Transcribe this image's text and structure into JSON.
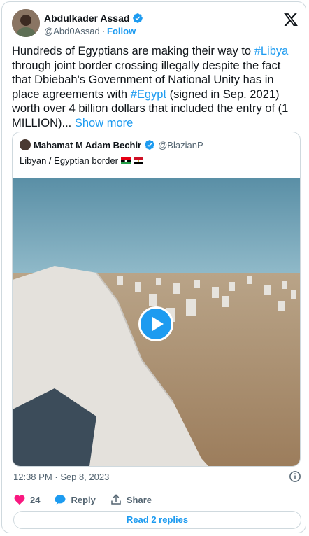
{
  "author": {
    "display_name": "Abdulkader Assad",
    "handle": "@Abd0Assad",
    "separator": "·",
    "follow_label": "Follow"
  },
  "tweet": {
    "text_parts": [
      "Hundreds of Egyptians are making their way to ",
      "#Libya",
      " through joint border crossing illegally despite the fact that Dbiebah's Government of National Unity has in place agreements with ",
      "#Egypt",
      " (signed in Sep. 2021) worth over 4 billion dollars that included the entry of (1 MILLION)... ",
      "Show more"
    ],
    "timestamp": "12:38 PM · Sep 8, 2023"
  },
  "quote": {
    "display_name": "Mahamat M Adam Bechir",
    "handle": "@BlazianP",
    "text": "Libyan / Egyptian border"
  },
  "actions": {
    "like_count": "24",
    "reply_label": "Reply",
    "share_label": "Share",
    "read_replies_label": "Read 2 replies"
  },
  "colors": {
    "accent": "#1d9bf0",
    "like": "#f91880",
    "muted": "#536471"
  },
  "icons": [
    "verified-badge-icon",
    "x-logo-icon",
    "play-icon",
    "info-icon",
    "heart-icon",
    "reply-icon",
    "share-icon"
  ]
}
